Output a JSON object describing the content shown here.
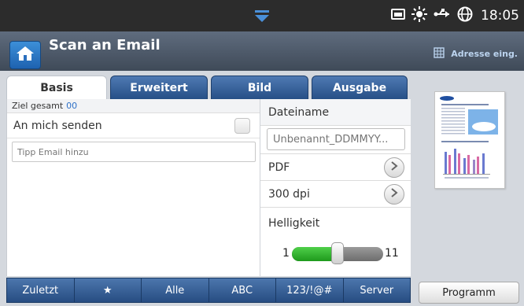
{
  "status_bar": {
    "time": "18:05",
    "icons": [
      "pull-down-icon",
      "storage-icon",
      "brightness-icon",
      "usb-icon",
      "globe-icon"
    ]
  },
  "header": {
    "title": "Scan an Email",
    "address_book_label": "Adresse eing."
  },
  "tabs": [
    {
      "label": "Basis",
      "active": true
    },
    {
      "label": "Erweitert",
      "active": false
    },
    {
      "label": "Bild",
      "active": false
    },
    {
      "label": "Ausgabe",
      "active": false
    }
  ],
  "recipients": {
    "total_label": "Ziel gesamt",
    "total_count": "00",
    "send_to_me_label": "An mich senden",
    "send_to_me_checked": false,
    "email_placeholder": "Tipp Email hinzu"
  },
  "options": {
    "filename_label": "Dateiname",
    "filename_value": "Unbenannt_DDMMYY...",
    "format_value": "PDF",
    "resolution_value": "300 dpi",
    "brightness_label": "Helligkeit",
    "brightness_min": "1",
    "brightness_max": "11",
    "brightness_level": 6
  },
  "toolbar": {
    "items": [
      "Zuletzt",
      "★",
      "Alle",
      "ABC",
      "123/!@#",
      "Server"
    ]
  },
  "program_label": "Programm",
  "colors": {
    "status_bar": "#2c2c2c",
    "accent_blue": "#2f71c8",
    "tab_blue": "#264f86",
    "slider_green": "#1e9a1c"
  }
}
